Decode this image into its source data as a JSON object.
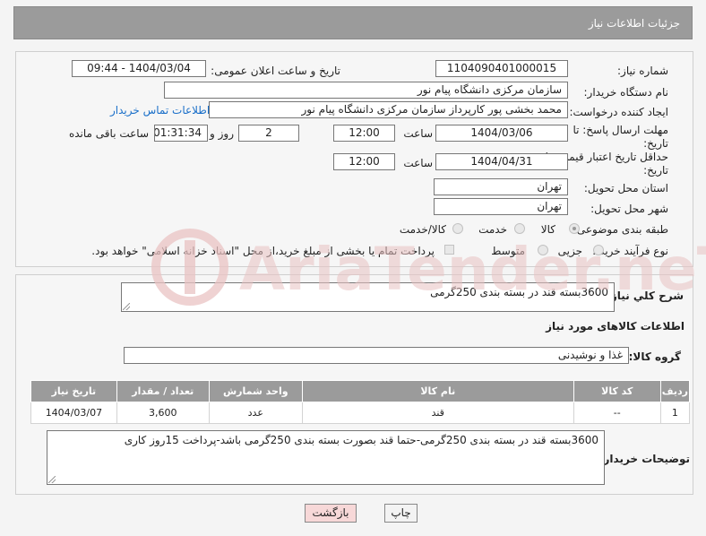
{
  "header": {
    "title": "جزئیات اطلاعات نیاز"
  },
  "labels": {
    "need_number": "شماره نیاز:",
    "announce_datetime": "تاریخ و ساعت اعلان عمومی:",
    "buyer_org": "نام دستگاه خریدار:",
    "creator": "ایجاد کننده درخواست:",
    "reply_deadline": "مهلت ارسال پاسخ: تا تاریخ:",
    "price_validity": "حداقل تاریخ اعتبار قیمت: تا تاریخ:",
    "delivery_province": "استان محل تحویل:",
    "delivery_city": "شهر محل تحویل:",
    "category": "طبقه بندی موضوعی:",
    "process_type": "نوع فرآیند خرید :",
    "time": "ساعت",
    "day_and": "روز و",
    "remaining": "ساعت باقی مانده",
    "general_desc": "شرح كلي نياز:",
    "items_info": "اطلاعات کالاهای مورد نیاز",
    "goods_group": "گروه کالا:",
    "buyer_notes": "توضیحات خریدار:"
  },
  "values": {
    "need_number": "1104090401000015",
    "announce_datetime": "1404/03/04 - 09:44",
    "buyer_org": "سازمان مرکزی دانشگاه پیام نور",
    "creator": "محمد بخشی پور کارپرداز سازمان مرکزی دانشگاه پیام نور",
    "contact_link": "اطلاعات تماس خریدار",
    "reply_date": "1404/03/06",
    "reply_time": "12:00",
    "reply_days": "2",
    "reply_remaining": "01:31:34",
    "validity_date": "1404/04/31",
    "validity_time": "12:00",
    "delivery_province": "تهران",
    "delivery_city": "تهران",
    "general_desc": "3600بسته قند در بسته بندی 250گرمی",
    "goods_group": "غذا و نوشیدنی",
    "buyer_notes": "3600بسته قند در بسته بندی 250گرمی-حتما قند بصورت بسته بندی 250گرمی باشد-پرداخت 15روز کاری"
  },
  "category_options": [
    {
      "label": "کالا",
      "selected": true
    },
    {
      "label": "خدمت",
      "selected": false
    },
    {
      "label": "کالا/خدمت",
      "selected": false
    }
  ],
  "process_options": [
    {
      "label": "جزیی",
      "selected": false
    },
    {
      "label": "متوسط",
      "selected": false
    }
  ],
  "payment_note": "پرداخت تمام یا بخشی از مبلغ خرید،از محل \"اسناد خزانه اسلامی\" خواهد بود.",
  "table": {
    "columns": [
      "ردیف",
      "کد کالا",
      "نام کالا",
      "واحد شمارش",
      "تعداد / مقدار",
      "تاریخ نیاز"
    ],
    "rows": [
      [
        "1",
        "--",
        "قند",
        "عدد",
        "3,600",
        "1404/03/07"
      ]
    ]
  },
  "buttons": {
    "print": "چاپ",
    "back": "بازگشت"
  },
  "watermark": {
    "text": "AriaTender.neT"
  },
  "colors": {
    "header_bg": "#9b9b9b",
    "link": "#1a6fc9",
    "back_button": "#f7d8d8",
    "watermark": "#e9c3c3"
  }
}
